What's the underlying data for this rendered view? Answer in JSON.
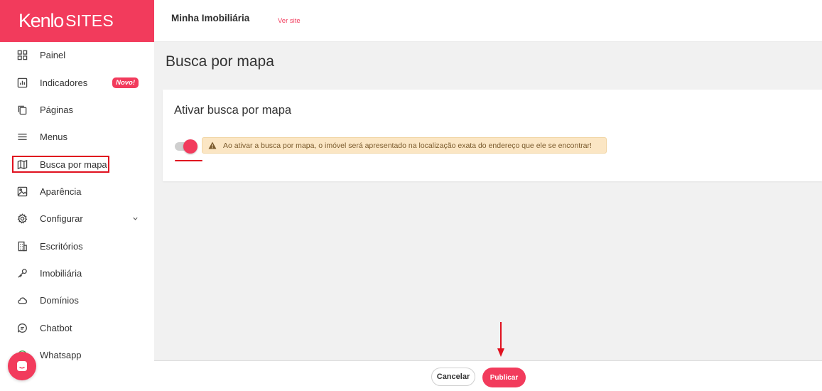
{
  "brand": {
    "logo": "Kenlo",
    "sub": "SITES"
  },
  "sidebar": {
    "items": [
      {
        "label": "Painel",
        "icon": "grid-icon"
      },
      {
        "label": "Indicadores",
        "icon": "bar-chart-icon",
        "badge": "Novo!"
      },
      {
        "label": "Páginas",
        "icon": "pages-icon"
      },
      {
        "label": "Menus",
        "icon": "menu-icon"
      },
      {
        "label": "Busca por mapa",
        "icon": "map-icon",
        "active": true
      },
      {
        "label": "Aparência",
        "icon": "image-icon"
      },
      {
        "label": "Configurar",
        "icon": "gear-icon"
      },
      {
        "label": "Escritórios",
        "icon": "building-icon"
      },
      {
        "label": "Imobiliária",
        "icon": "key-icon"
      },
      {
        "label": "Domínios",
        "icon": "cloud-icon"
      },
      {
        "label": "Chatbot",
        "icon": "chat-bubble-icon"
      },
      {
        "label": "Whatsapp",
        "icon": "whatsapp-icon"
      }
    ]
  },
  "topbar": {
    "site_name": "Minha Imobiliária",
    "ver_site": "Ver site"
  },
  "main": {
    "page_title": "Busca por mapa",
    "card_title": "Ativar busca por mapa",
    "toggle_on": true,
    "alert_text": "Ao ativar a busca por mapa, o imóvel será apresentado na localização exata do endereço que ele se encontrar!"
  },
  "footer": {
    "cancel_label": "Cancelar",
    "publish_label": "Publicar"
  },
  "colors": {
    "brand": "#f23b5c",
    "annotation": "#e0111f",
    "alert_bg": "#fbe6c4"
  }
}
